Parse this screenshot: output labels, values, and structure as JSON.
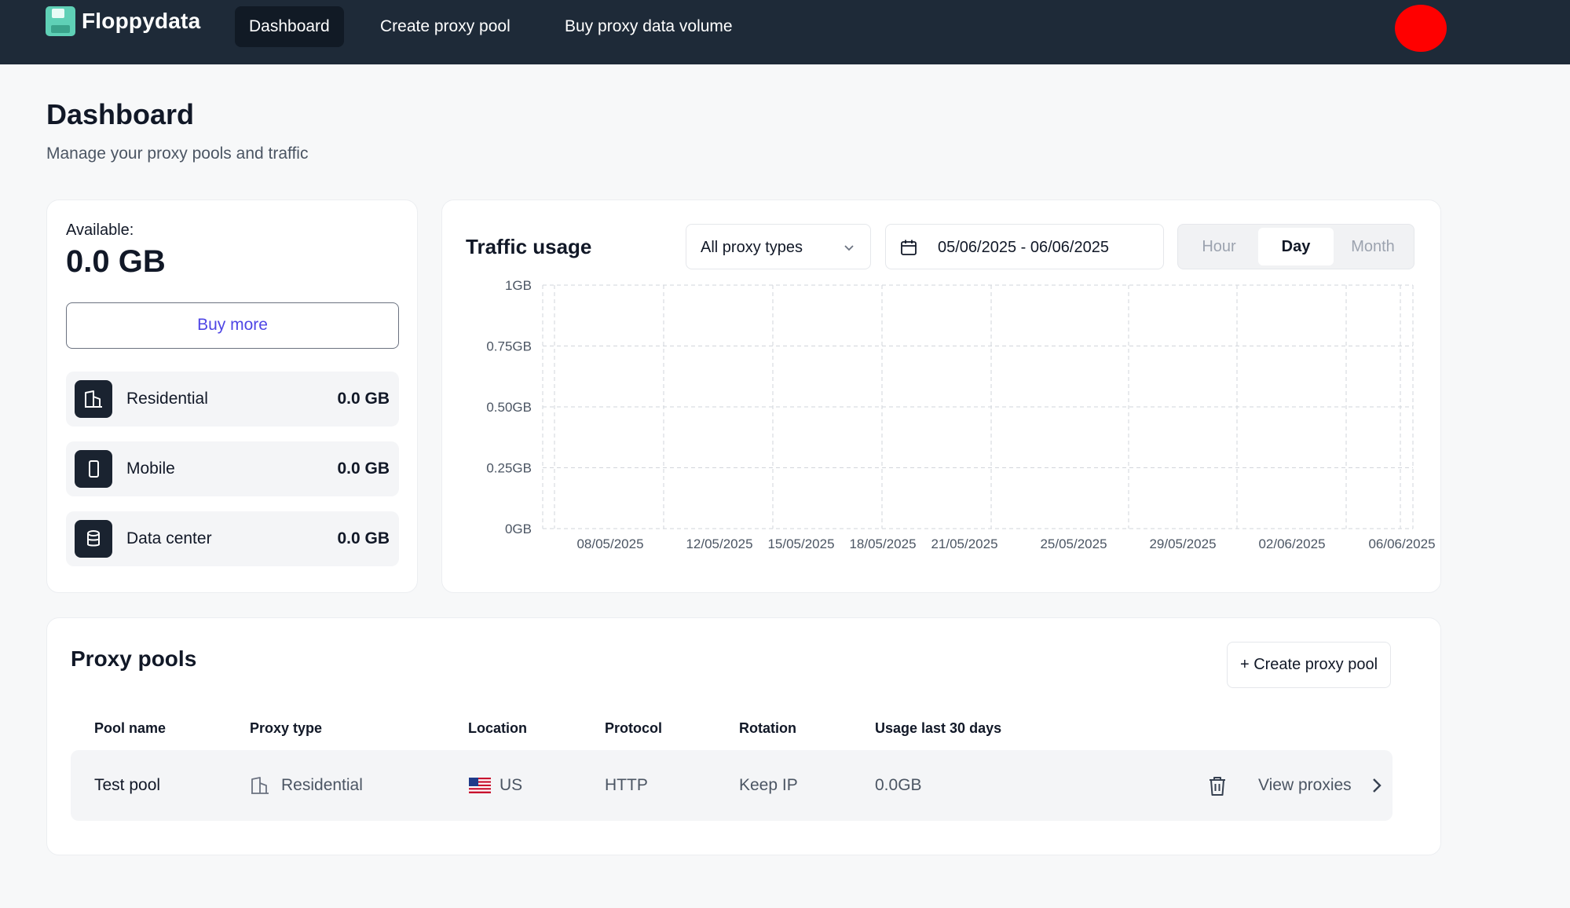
{
  "app": {
    "name": "Floppydata"
  },
  "nav": {
    "items": [
      {
        "label": "Dashboard",
        "active": true
      },
      {
        "label": "Create proxy pool",
        "active": false
      },
      {
        "label": "Buy proxy data volume",
        "active": false
      }
    ]
  },
  "header": {
    "title": "Dashboard",
    "subtitle": "Manage your proxy pools and traffic"
  },
  "available": {
    "label": "Available:",
    "value": "0.0 GB",
    "buy_more_label": "Buy more",
    "types": [
      {
        "label": "Residential",
        "value": "0.0 GB",
        "icon": "building-icon"
      },
      {
        "label": "Mobile",
        "value": "0.0 GB",
        "icon": "mobile-icon"
      },
      {
        "label": "Data center",
        "value": "0.0 GB",
        "icon": "database-icon"
      }
    ]
  },
  "traffic": {
    "title": "Traffic usage",
    "proxy_type_select": "All proxy types",
    "date_range": "05/06/2025 - 06/06/2025",
    "granularity": [
      "Hour",
      "Day",
      "Month"
    ],
    "granularity_selected": "Day"
  },
  "chart_data": {
    "type": "line",
    "title": "Traffic usage",
    "x": [
      "08/05/2025",
      "12/05/2025",
      "15/05/2025",
      "18/05/2025",
      "21/05/2025",
      "25/05/2025",
      "29/05/2025",
      "02/06/2025",
      "06/06/2025"
    ],
    "y_ticks": [
      "0GB",
      "0.25GB",
      "0.50GB",
      "0.75GB",
      "1GB"
    ],
    "ylim": [
      0,
      1
    ],
    "series": [
      {
        "values": [
          0,
          0,
          0,
          0,
          0,
          0,
          0,
          0,
          0
        ]
      }
    ],
    "grid": true
  },
  "pools": {
    "title": "Proxy pools",
    "create_label": "Create proxy pool",
    "columns": [
      "Pool name",
      "Proxy type",
      "Location",
      "Protocol",
      "Rotation",
      "Usage last 30 days"
    ],
    "rows": [
      {
        "name": "Test pool",
        "type": "Residential",
        "location": "US",
        "protocol": "HTTP",
        "rotation": "Keep IP",
        "usage": "0.0GB",
        "view_label": "View proxies"
      }
    ]
  },
  "colors": {
    "nav_bg": "#1e2a38",
    "accent": "#4f46e5",
    "avatar": "#ff0000"
  }
}
